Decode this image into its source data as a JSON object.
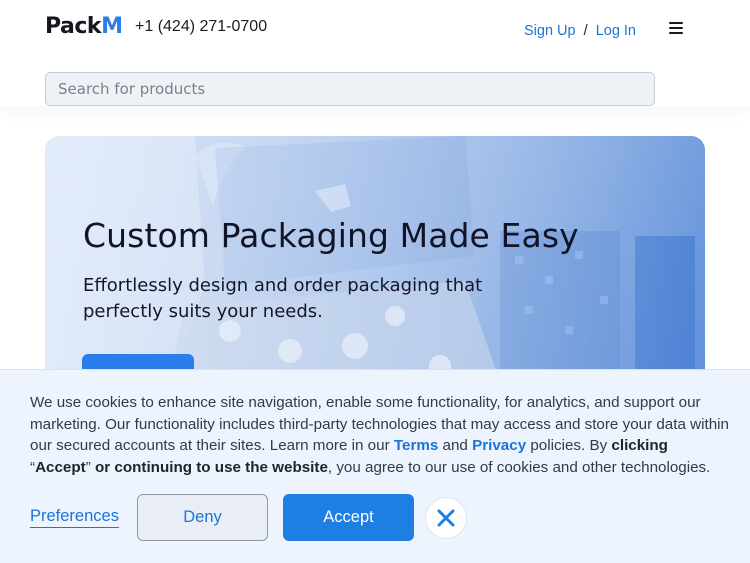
{
  "header": {
    "logo_main": "Pack",
    "logo_accent": "M",
    "phone": "+1 (424) 271-0700",
    "sign_up": "Sign Up",
    "separator": "/",
    "log_in": "Log In",
    "menu_icon": "hamburger-menu-icon"
  },
  "search": {
    "placeholder": "Search for products",
    "value": ""
  },
  "hero": {
    "title": "Custom Packaging Made Easy",
    "subtitle": "Effortlessly design and order packaging that perfectly suits your needs."
  },
  "cookie_banner": {
    "text_part1": "We use cookies to enhance site navigation, enable some functionality, for analytics, and support our marketing. Our functionality includes third-party technologies that may access and store your data within our secured accounts at their sites. Learn more in our ",
    "terms_link": "Terms",
    "and": " and ",
    "privacy_link": "Privacy",
    "text_part2": " policies. By ",
    "bold_clicking": "clicking",
    "open_quote": " “",
    "bold_accept": "Accept",
    "close_quote": "” ",
    "bold_continue": "or continuing to use the website",
    "text_part3": ", you agree to our use of cookies and other technologies.",
    "preferences_label": "Preferences",
    "deny_label": "Deny",
    "accept_label": "Accept",
    "close_icon": "close-x-icon"
  },
  "colors": {
    "accent": "#2b7de9",
    "link": "#1b74d9",
    "banner_bg": "#edf4fd",
    "hero_blue": "#4f86d9"
  }
}
